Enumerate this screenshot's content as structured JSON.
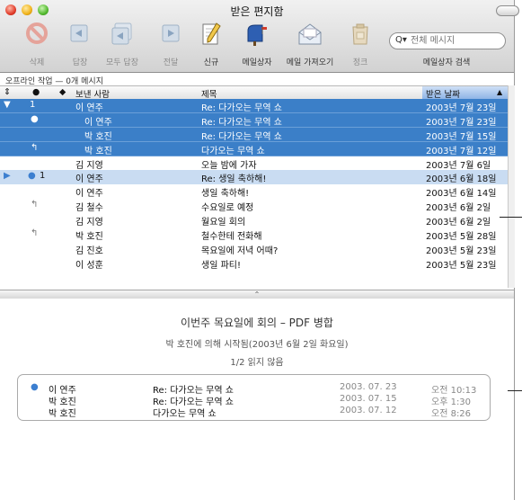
{
  "window": {
    "title": "받은 편지함"
  },
  "toolbar": [
    {
      "icon": "delete-icon",
      "label": "삭제",
      "enabled": false
    },
    {
      "icon": "reply-icon",
      "label": "답장",
      "enabled": false
    },
    {
      "icon": "reply-all-icon",
      "label": "모두 답장",
      "enabled": false
    },
    {
      "icon": "forward-icon",
      "label": "전달",
      "enabled": false
    },
    {
      "icon": "new-message-icon",
      "label": "신규",
      "enabled": true
    },
    {
      "icon": "mailbox-icon",
      "label": "메일상자",
      "enabled": true
    },
    {
      "icon": "get-mail-icon",
      "label": "메일 가져오기",
      "enabled": true
    },
    {
      "icon": "junk-icon",
      "label": "정크",
      "enabled": false
    }
  ],
  "search": {
    "placeholder": "전체 메시지",
    "label": "메일상자 검색"
  },
  "status": "오프라인 작업 — 0개 메시지",
  "columns": {
    "from": "보낸 사람",
    "subject": "제목",
    "date": "받은 날짜"
  },
  "messages": [
    {
      "thread": "1",
      "from": "이 연주",
      "subject": "Re: 다가오는 무역 쇼",
      "date": "2003년 7월 23일",
      "state": "selected",
      "marker": "expanded"
    },
    {
      "from": "이 연주",
      "subject": "Re: 다가오는 무역 쇼",
      "date": "2003년 7월 23일",
      "state": "selected",
      "marker": "unread",
      "indent": true
    },
    {
      "from": "박 호진",
      "subject": "Re: 다가오는 무역 쇼",
      "date": "2003년 7월 15일",
      "state": "selected",
      "indent": true
    },
    {
      "from": "박 호진",
      "subject": "다가오는 무역 쇼",
      "date": "2003년 7월 12일",
      "state": "selected",
      "marker": "replied",
      "indent": true
    },
    {
      "from": "김 지영",
      "subject": "오늘 밤에 가자",
      "date": "2003년 7월 6일"
    },
    {
      "thread": "1",
      "from": "이 연주",
      "subject": "Re: 생일 축하해!",
      "date": "2003년 6월 18일",
      "state": "highlighted",
      "marker": "collapsed"
    },
    {
      "from": "이 연주",
      "subject": "생일 축하해!",
      "date": "2003년 6월 14일"
    },
    {
      "from": "김 철수",
      "subject": "수요일로 예정",
      "date": "2003년 6월 2일",
      "marker": "replied"
    },
    {
      "from": "김 지영",
      "subject": "월요일 회의",
      "date": "2003년 6월 2일"
    },
    {
      "from": "박 호진",
      "subject": "철수한테 전화해",
      "date": "2003년 5월 28일",
      "marker": "replied"
    },
    {
      "from": "김 진호",
      "subject": "목요일에 저녁 어때?",
      "date": "2003년 5월 23일"
    },
    {
      "from": "이 성훈",
      "subject": "생일 파티!",
      "date": "2003년 5월 23일"
    }
  ],
  "preview": {
    "title": "이번주 목요일에 회의 – PDF 병합",
    "subtitle": "박 호진에 의해 시작됨(2003년 6월 2일 화요일)",
    "count": "1/2 읽지 않음",
    "thread": [
      {
        "from": "이 연주",
        "subject": "Re: 다가오는 무역 쇼",
        "date": "2003. 07. 23",
        "time": "오전 10:13",
        "unread": true
      },
      {
        "from": "박 호진",
        "subject": "Re: 다가오는 무역 쇼",
        "date": "2003. 07. 15",
        "time": "오후 1:30"
      },
      {
        "from": "박 호진",
        "subject": "다가오는 무역 쇼",
        "date": "2003. 07. 12",
        "time": "오전 8:26"
      }
    ]
  },
  "colors": {
    "selection": "#3b7fc8",
    "highlight": "#c9dcf2",
    "unread_dot": "#3c7fd0"
  }
}
